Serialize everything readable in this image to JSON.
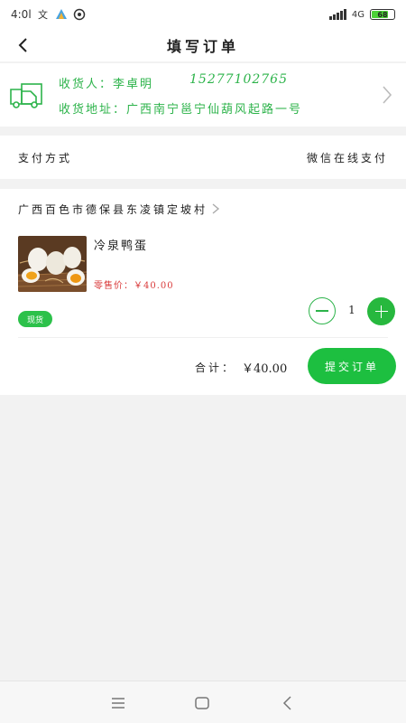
{
  "status_bar": {
    "time": "4:0l",
    "network": "4G",
    "battery": "68"
  },
  "header": {
    "title": "填写订单"
  },
  "address": {
    "receiver_label": "收货人：",
    "receiver_name": "李卓明",
    "phone": "15277102765",
    "address_label": "收货地址：",
    "address_text": "广西南宁邕宁仙葫风起路一号"
  },
  "payment": {
    "label": "支付方式",
    "value": "微信在线支付"
  },
  "shop": {
    "location": "广西百色市德保县东凌镇定坡村",
    "product": {
      "name": "冷泉鸭蛋",
      "price_label": "零售价：",
      "price": "￥40.00",
      "badge": "现货",
      "quantity": "1"
    }
  },
  "footer": {
    "total_label": "合计：",
    "total_value": "￥40.00",
    "submit_label": "提交订单"
  },
  "colors": {
    "accent": "#1dbf40",
    "price": "#d93a3a",
    "background": "#f2f2f2"
  }
}
